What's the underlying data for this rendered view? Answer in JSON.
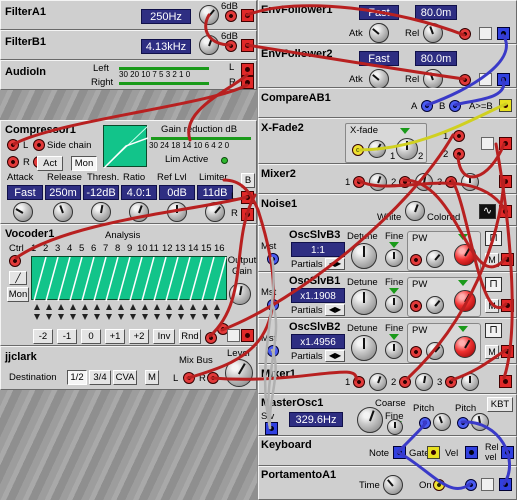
{
  "colors": {
    "panel": "#cfcfcf",
    "lcd": "#2e2e82",
    "jack_red": "#e02828",
    "jack_blue": "#3040e0",
    "cable_red": "#b82020",
    "cable_blue": "#3a3ac8",
    "cable_yellow": "#d0d020",
    "analysis_green": "#12c48a"
  },
  "left": {
    "filterA1": {
      "title": "FilterA1",
      "freq": "250Hz",
      "slope": "6dB"
    },
    "filterB1": {
      "title": "FilterB1",
      "freq": "4.13kHz",
      "slope": "6dB"
    },
    "audioin": {
      "title": "AudioIn",
      "left": "Left",
      "right": "Right",
      "scale": "30 20 10 7 5 3 2 1 0",
      "l": "L",
      "r": "R"
    },
    "compressor": {
      "title": "Compressor1",
      "gain_reduction": "Gain reduction dB",
      "gr_scale": "30 24 18 14 10 6 4 2 0",
      "l": "L",
      "r": "R",
      "side_chain": "Side chain",
      "act": "Act",
      "mon": "Mon",
      "lim_active": "Lim Active",
      "labels": [
        "Attack",
        "Release",
        "Thresh.",
        "Ratio",
        "Ref Lvl",
        "Limiter"
      ],
      "values": [
        "Fast",
        "250m",
        "-12dB",
        "4.0:1",
        "0dB",
        "11dB"
      ],
      "b": "B"
    },
    "vocoder": {
      "title": "Vocoder1",
      "analysis": "Analysis",
      "ctrl": "Ctrl",
      "mon": "Mon",
      "bands": [
        "1",
        "2",
        "3",
        "4",
        "5",
        "6",
        "7",
        "8",
        "9",
        "10",
        "11",
        "12",
        "13",
        "14",
        "15",
        "16"
      ],
      "output_gain": "Output Gain",
      "shift_buttons": [
        "-2",
        "-1",
        "0",
        "+1",
        "+2",
        "Inv",
        "Rnd"
      ]
    },
    "jjclark": {
      "title": "jjclark",
      "mix_bus": "Mix Bus",
      "level": "Level",
      "destination": "Destination",
      "dest_options": [
        "1/2",
        "3/4",
        "CVA"
      ],
      "m": "M",
      "l": "L",
      "r": "R"
    }
  },
  "right": {
    "envfollower1": {
      "title": "EnvFollower1",
      "attack_lcd": "Fast",
      "release_lcd": "80.0m",
      "atk": "Atk",
      "rel": "Rel"
    },
    "envfollower2": {
      "title": "EnvFollower2",
      "attack_lcd": "Fast",
      "release_lcd": "80.0m",
      "atk": "Atk",
      "rel": "Rel"
    },
    "compareab": {
      "title": "CompareAB1",
      "a": "A",
      "b": "B",
      "cmp": "A>=B"
    },
    "xfade": {
      "title": "X-Fade2",
      "xfade": "X-fade",
      "in1": "1",
      "in2": "2",
      "k1": "1",
      "k2": "2"
    },
    "mixer2": {
      "title": "Mixer2",
      "i1": "1",
      "i2": "2",
      "i3": "3"
    },
    "noise": {
      "title": "Noise1",
      "white": "White",
      "colored": "Colored"
    },
    "oscs": [
      {
        "title": "OscSlvB3",
        "mst": "Mst",
        "ratio": "1:1",
        "partials": "Partials",
        "detune": "Detune",
        "fine": "Fine",
        "pw": "PW"
      },
      {
        "title": "OscSlvB1",
        "mst": "Mst",
        "ratio": "x1.1908",
        "partials": "Partials",
        "detune": "Detune",
        "fine": "Fine",
        "pw": "PW"
      },
      {
        "title": "OscSlvB2",
        "mst": "Mst",
        "ratio": "x1.4956",
        "partials": "Partials",
        "detune": "Detune",
        "fine": "Fine",
        "pw": "PW"
      }
    ],
    "mixer1": {
      "title": "Mixer1",
      "i1": "1",
      "i2": "2",
      "i3": "3"
    },
    "masterosc": {
      "title": "MasterOsc1",
      "coarse": "Coarse",
      "freq": "329.6Hz",
      "fine": "Fine",
      "pitch1": "Pitch",
      "pitch2": "Pitch",
      "kbt": "KBT",
      "slv": "Slv"
    },
    "keyboard": {
      "title": "Keyboard",
      "note": "Note",
      "gate": "Gate",
      "vel": "Vel",
      "rel_vel": "Rel vel"
    },
    "portamento": {
      "title": "PortamentoA1",
      "time": "Time",
      "on": "On"
    }
  }
}
